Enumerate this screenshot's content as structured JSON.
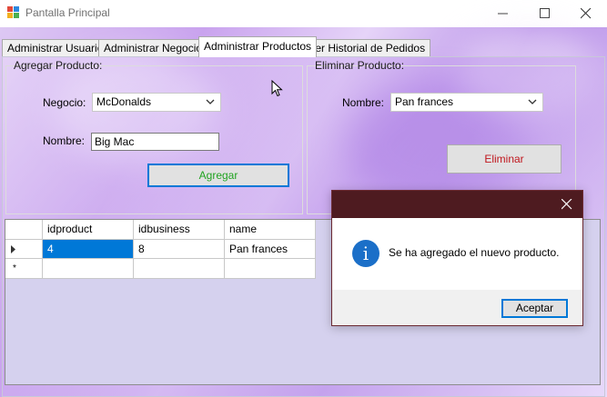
{
  "window": {
    "title": "Pantalla Principal",
    "icon": "winforms-app-icon",
    "controls": [
      "minimize-icon",
      "maximize-icon",
      "close-icon"
    ]
  },
  "tabs": [
    {
      "label": "Administrar Usuarios",
      "active": false
    },
    {
      "label": "Administrar Negocios",
      "active": false
    },
    {
      "label": "Administrar Productos",
      "active": true
    },
    {
      "label": "Ver Historial de Pedidos",
      "active": false
    }
  ],
  "add_product": {
    "title": "Agregar Producto:",
    "business_label": "Negocio:",
    "business_value": "McDonalds",
    "name_label": "Nombre:",
    "name_value": "Big Mac",
    "button_label": "Agregar",
    "button_color": "#21a321"
  },
  "delete_product": {
    "title": "Eliminar Producto:",
    "name_label": "Nombre:",
    "name_value": "Pan frances",
    "button_label": "Eliminar",
    "button_color": "#c0171e"
  },
  "grid": {
    "columns": [
      "idproduct",
      "idbusiness",
      "name"
    ],
    "rows": [
      {
        "indicator": "current-row-arrow",
        "cells": [
          "4",
          "8",
          "Pan frances"
        ]
      },
      {
        "indicator": "new-row-asterisk",
        "cells": [
          "",
          "",
          ""
        ]
      }
    ],
    "new_row_glyph": "*"
  },
  "dialog": {
    "message": "Se ha agregado el nuevo producto.",
    "icon": "info-icon",
    "ok_label": "Aceptar",
    "titlebar_color": "#4e1b20"
  },
  "colors": {
    "selection": "#0078d7",
    "grid_background": "#d5d1ee"
  }
}
